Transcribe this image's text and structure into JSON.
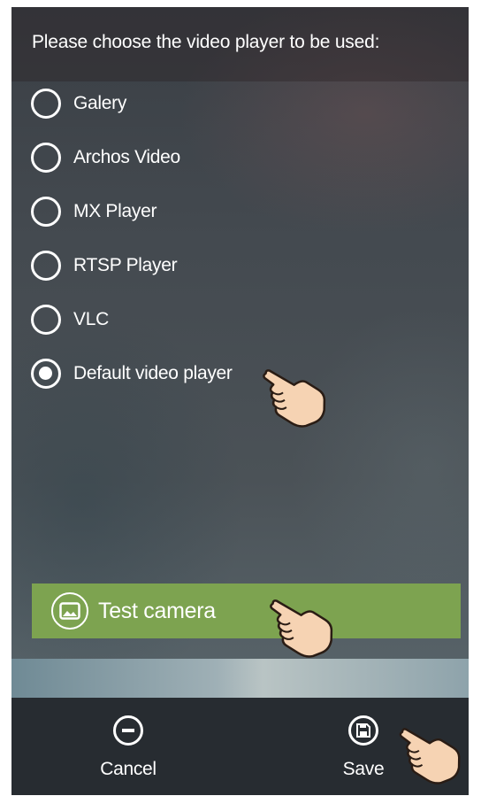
{
  "header": {
    "title": "Please choose the video player to be used:"
  },
  "options": [
    {
      "label": "Galery",
      "checked": false
    },
    {
      "label": "Archos Video",
      "checked": false
    },
    {
      "label": "MX Player",
      "checked": false
    },
    {
      "label": "RTSP Player",
      "checked": false
    },
    {
      "label": "VLC",
      "checked": false
    },
    {
      "label": "Default video player",
      "checked": true
    }
  ],
  "test_button": {
    "label": "Test camera",
    "color": "#7da350",
    "icon": "image-icon"
  },
  "bottom_bar": {
    "cancel": {
      "label": "Cancel",
      "icon": "minus-circle-icon"
    },
    "save": {
      "label": "Save",
      "icon": "floppy-disk-icon"
    }
  },
  "colors": {
    "bar_background": "#272c31",
    "text": "#ffffff"
  }
}
